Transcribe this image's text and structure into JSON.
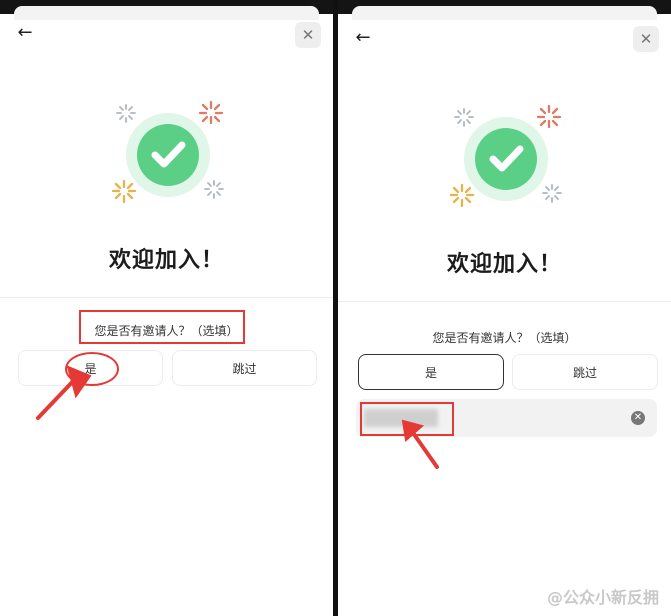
{
  "screens": [
    {
      "id": "left",
      "header": {
        "back_icon": "arrow-left-icon",
        "close_icon": "close-icon"
      },
      "welcome_title": "欢迎加入！",
      "question": "您是否有邀请人？（选填）",
      "yes_label": "是",
      "skip_label": "跳过",
      "selected": "none"
    },
    {
      "id": "right",
      "header": {
        "back_icon": "arrow-left-icon",
        "close_icon": "close-icon"
      },
      "welcome_title": "欢迎加入！",
      "question": "您是否有邀请人？（选填）",
      "yes_label": "是",
      "skip_label": "跳过",
      "selected": "yes",
      "inviter_input": {
        "value_state": "blurred",
        "clear_icon": "clear-circle-icon"
      }
    }
  ],
  "icons": {
    "success": "check-circle-icon",
    "confetti": "sparkle-icon"
  },
  "colors": {
    "success_green": "#5ccf87",
    "success_ring": "#dff6e8",
    "annotation_red": "#e53935",
    "confetti_orange": "#e8b24a",
    "confetti_red": "#e07a63",
    "confetti_gray": "#aeb6bc"
  },
  "watermark": "@公众小新反拥"
}
